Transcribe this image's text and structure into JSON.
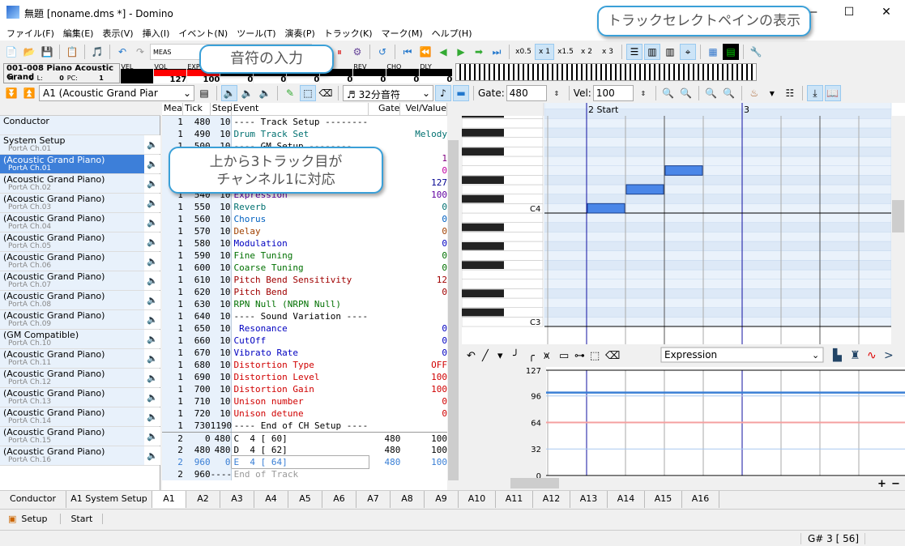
{
  "window": {
    "title": "無題 [noname.dms *] - Domino",
    "min": "—",
    "max": "☐",
    "close": "✕"
  },
  "menu": [
    "ファイル(F)",
    "編集(E)",
    "表示(V)",
    "挿入(I)",
    "イベント(N)",
    "ツール(T)",
    "演奏(P)",
    "トラック(K)",
    "マーク(M)",
    "ヘルプ(H)"
  ],
  "toolbar": {
    "meas_label": "MEAS",
    "position_tail": "00",
    "speeds": [
      "x0.5",
      "x 1",
      "x1.5",
      "x 2",
      "x 3"
    ],
    "active_speed": "x 1"
  },
  "info": {
    "instrument": "001-008 Piano Acoustic Grand",
    "m_label": "M:",
    "m": "0",
    "l_label": "L:",
    "l": "0",
    "pc_label": "PC:",
    "pc": "1",
    "meters": [
      {
        "label": "VEL",
        "value": ""
      },
      {
        "label": "VOL",
        "value": "127"
      },
      {
        "label": "EXP",
        "value": "100"
      },
      {
        "label": "",
        "value": "0"
      },
      {
        "label": "",
        "value": "0"
      },
      {
        "label": "",
        "value": "0"
      },
      {
        "label": "O",
        "value": "0"
      },
      {
        "label": "REV",
        "value": "0"
      },
      {
        "label": "CHO",
        "value": "0"
      },
      {
        "label": "DLY",
        "value": "0"
      }
    ]
  },
  "editbar": {
    "track_select": "A1 (Acoustic Grand Piar",
    "note_length": "32分音符",
    "gate_label": "Gate:",
    "gate": "480",
    "vel_label": "Vel:",
    "vel": "100"
  },
  "tracks": [
    {
      "name": "Conductor",
      "port": ""
    },
    {
      "name": "System Setup",
      "port": "PortA  Ch.01"
    },
    {
      "name": "(Acoustic Grand Piano)",
      "port": "PortA  Ch.01"
    },
    {
      "name": "(Acoustic Grand Piano)",
      "port": "PortA  Ch.02"
    },
    {
      "name": "(Acoustic Grand Piano)",
      "port": "PortA  Ch.03"
    },
    {
      "name": "(Acoustic Grand Piano)",
      "port": "PortA  Ch.04"
    },
    {
      "name": "(Acoustic Grand Piano)",
      "port": "PortA  Ch.05"
    },
    {
      "name": "(Acoustic Grand Piano)",
      "port": "PortA  Ch.06"
    },
    {
      "name": "(Acoustic Grand Piano)",
      "port": "PortA  Ch.07"
    },
    {
      "name": "(Acoustic Grand Piano)",
      "port": "PortA  Ch.08"
    },
    {
      "name": "(Acoustic Grand Piano)",
      "port": "PortA  Ch.09"
    },
    {
      "name": "(GM Compatible)",
      "port": "PortA  Ch.10"
    },
    {
      "name": "(Acoustic Grand Piano)",
      "port": "PortA  Ch.11"
    },
    {
      "name": "(Acoustic Grand Piano)",
      "port": "PortA  Ch.12"
    },
    {
      "name": "(Acoustic Grand Piano)",
      "port": "PortA  Ch.13"
    },
    {
      "name": "(Acoustic Grand Piano)",
      "port": "PortA  Ch.14"
    },
    {
      "name": "(Acoustic Grand Piano)",
      "port": "PortA  Ch.15"
    },
    {
      "name": "(Acoustic Grand Piano)",
      "port": "PortA  Ch.16"
    }
  ],
  "events": {
    "headers": [
      "Mea",
      "Tick",
      "Step",
      "Event",
      "Gate",
      "Vel/Value"
    ],
    "rows": [
      [
        "1",
        "480",
        "10",
        "---- Track Setup -------------------",
        "",
        "",
        "#000"
      ],
      [
        "1",
        "490",
        "10",
        "Drum Track Set",
        "",
        "Melody",
        "#007070"
      ],
      [
        "1",
        "500",
        "10",
        "---- GM Setup --------",
        "",
        "",
        "#000"
      ],
      [
        "1",
        "510",
        "10",
        "",
        "",
        "1",
        "#800080"
      ],
      [
        "1",
        "520",
        "10",
        "",
        "",
        "0",
        "#c000a0"
      ],
      [
        "1",
        "530",
        "10",
        "",
        "",
        "127",
        "#000090"
      ],
      [
        "1",
        "540",
        "10",
        "Expression",
        "",
        "100",
        "#6000a0"
      ],
      [
        "1",
        "550",
        "10",
        "Reverb",
        "",
        "0",
        "#007070"
      ],
      [
        "1",
        "560",
        "10",
        "Chorus",
        "",
        "0",
        "#0060c0"
      ],
      [
        "1",
        "570",
        "10",
        "Delay",
        "",
        "0",
        "#a04000"
      ],
      [
        "1",
        "580",
        "10",
        "Modulation",
        "",
        "0",
        "#0000c0"
      ],
      [
        "1",
        "590",
        "10",
        "Fine Tuning",
        "",
        "0",
        "#007000"
      ],
      [
        "1",
        "600",
        "10",
        "Coarse Tuning",
        "",
        "0",
        "#007000"
      ],
      [
        "1",
        "610",
        "10",
        "Pitch Bend Sensitivity",
        "",
        "12",
        "#a00000"
      ],
      [
        "1",
        "620",
        "10",
        "Pitch Bend",
        "",
        "0",
        "#a00000"
      ],
      [
        "1",
        "630",
        "10",
        "RPN Null (NRPN Null)",
        "",
        "",
        "#007000"
      ],
      [
        "1",
        "640",
        "10",
        "---- Sound Variation ---------------",
        "",
        "",
        "#000"
      ],
      [
        "1",
        "650",
        "10",
        " Resonance",
        "",
        "0",
        "#0000c0"
      ],
      [
        "1",
        "660",
        "10",
        "CutOff",
        "",
        "0",
        "#0000c0"
      ],
      [
        "1",
        "670",
        "10",
        "Vibrato Rate",
        "",
        "0",
        "#0000c0"
      ],
      [
        "1",
        "680",
        "10",
        "Distortion Type",
        "",
        "OFF",
        "#d00000"
      ],
      [
        "1",
        "690",
        "10",
        "Distortion Level",
        "",
        "100",
        "#d00000"
      ],
      [
        "1",
        "700",
        "10",
        "Distortion Gain",
        "",
        "100",
        "#d00000"
      ],
      [
        "1",
        "710",
        "10",
        "Unison number",
        "",
        "0",
        "#d00000"
      ],
      [
        "1",
        "720",
        "10",
        "Unison detune",
        "",
        "0",
        "#d00000"
      ],
      [
        "1",
        "730",
        "1190",
        "---- End of CH Setup ---------------",
        "",
        "",
        "#000"
      ],
      [
        "2",
        "0",
        "480",
        "C  4 [ 60]",
        "480",
        "100",
        "#000"
      ],
      [
        "2",
        "480",
        "480",
        "D  4 [ 62]",
        "480",
        "100",
        "#000"
      ],
      [
        "2",
        "960",
        "0",
        "E  4 [ 64]",
        "480",
        "100",
        "#3a7fd5"
      ],
      [
        "2",
        "960",
        "----",
        "End of Track",
        "",
        "",
        "#999"
      ]
    ]
  },
  "pianoroll": {
    "measures": [
      "2 Start",
      "3"
    ],
    "key_labels": [
      "C4",
      "C3"
    ],
    "notes": [
      {
        "pitch": "C4",
        "start_tick": 0,
        "gate": 480
      },
      {
        "pitch": "D4",
        "start_tick": 480,
        "gate": 480
      },
      {
        "pitch": "E4",
        "start_tick": 960,
        "gate": 480
      }
    ]
  },
  "control": {
    "type_select": "Expression",
    "y_ticks": [
      "127",
      "96",
      "64",
      "32",
      "0"
    ],
    "value": 100
  },
  "tabs": [
    "Conductor",
    "A1 System Setup",
    "A1",
    "A2",
    "A3",
    "A4",
    "A5",
    "A6",
    "A7",
    "A8",
    "A9",
    "A10",
    "A11",
    "A12",
    "A13",
    "A14",
    "A15",
    "A16"
  ],
  "active_tab": "A1",
  "bottombar": {
    "setup": "Setup",
    "start": "Start"
  },
  "status": {
    "pitch": "G# 3 [ 56]"
  },
  "callouts": {
    "note_input": "音符の入力",
    "track_pane": "トラックセレクトペインの表示",
    "channel_line1": "上から3トラック目が",
    "channel_line2": "チャンネル1に対応"
  },
  "colors": {
    "accent": "#3d7fd9",
    "note": "#4a86e8",
    "callout_border": "#3aa0d8"
  }
}
